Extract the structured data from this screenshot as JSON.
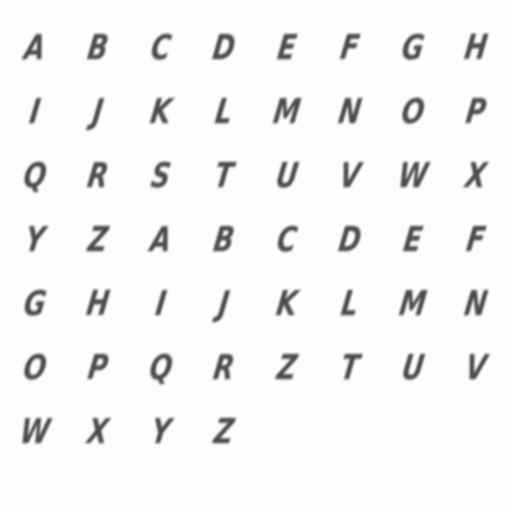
{
  "glyphs": [
    "A",
    "B",
    "C",
    "D",
    "E",
    "F",
    "G",
    "H",
    "I",
    "J",
    "K",
    "L",
    "M",
    "N",
    "O",
    "P",
    "Q",
    "R",
    "S",
    "T",
    "U",
    "V",
    "W",
    "X",
    "Y",
    "Z",
    "A",
    "B",
    "C",
    "D",
    "E",
    "F",
    "G",
    "H",
    "I",
    "J",
    "K",
    "L",
    "M",
    "N",
    "O",
    "P",
    "Q",
    "R",
    "Z",
    "T",
    "U",
    "V",
    "W",
    "X",
    "Y",
    "Z"
  ],
  "colors": {
    "background": "#fdfdfd",
    "glyph": "#3c3c3c"
  }
}
